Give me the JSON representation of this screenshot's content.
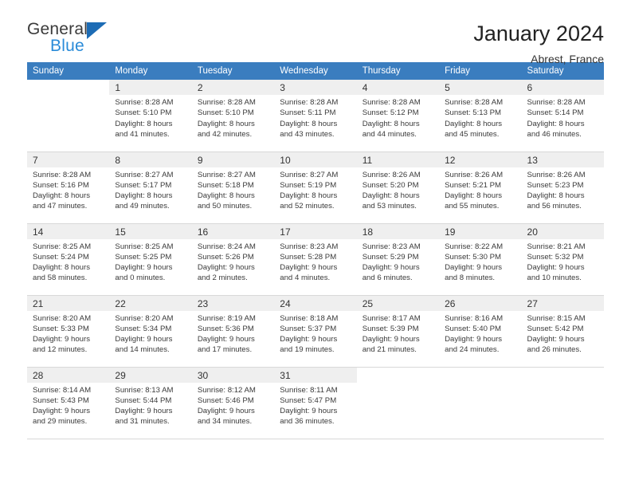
{
  "logo": {
    "word1": "General",
    "word2": "Blue",
    "triangle_color": "#1d6cb5",
    "blue_color": "#2a8bd8"
  },
  "header": {
    "title": "January 2024",
    "subtitle": "Abrest, France"
  },
  "theme": {
    "header_bar": "#3a7dbf",
    "row_shade": "#efefef",
    "text": "#333333"
  },
  "weekdays": [
    "Sunday",
    "Monday",
    "Tuesday",
    "Wednesday",
    "Thursday",
    "Friday",
    "Saturday"
  ],
  "labels": {
    "sunrise": "Sunrise",
    "sunset": "Sunset",
    "daylight": "Daylight"
  },
  "weeks": [
    {
      "shaded": true,
      "days": [
        {
          "num": "",
          "info": ""
        },
        {
          "num": "1",
          "info": "Sunrise: 8:28 AM\nSunset: 5:10 PM\nDaylight: 8 hours\nand 41 minutes."
        },
        {
          "num": "2",
          "info": "Sunrise: 8:28 AM\nSunset: 5:10 PM\nDaylight: 8 hours\nand 42 minutes."
        },
        {
          "num": "3",
          "info": "Sunrise: 8:28 AM\nSunset: 5:11 PM\nDaylight: 8 hours\nand 43 minutes."
        },
        {
          "num": "4",
          "info": "Sunrise: 8:28 AM\nSunset: 5:12 PM\nDaylight: 8 hours\nand 44 minutes."
        },
        {
          "num": "5",
          "info": "Sunrise: 8:28 AM\nSunset: 5:13 PM\nDaylight: 8 hours\nand 45 minutes."
        },
        {
          "num": "6",
          "info": "Sunrise: 8:28 AM\nSunset: 5:14 PM\nDaylight: 8 hours\nand 46 minutes."
        }
      ]
    },
    {
      "shaded": true,
      "days": [
        {
          "num": "7",
          "info": "Sunrise: 8:28 AM\nSunset: 5:16 PM\nDaylight: 8 hours\nand 47 minutes."
        },
        {
          "num": "8",
          "info": "Sunrise: 8:27 AM\nSunset: 5:17 PM\nDaylight: 8 hours\nand 49 minutes."
        },
        {
          "num": "9",
          "info": "Sunrise: 8:27 AM\nSunset: 5:18 PM\nDaylight: 8 hours\nand 50 minutes."
        },
        {
          "num": "10",
          "info": "Sunrise: 8:27 AM\nSunset: 5:19 PM\nDaylight: 8 hours\nand 52 minutes."
        },
        {
          "num": "11",
          "info": "Sunrise: 8:26 AM\nSunset: 5:20 PM\nDaylight: 8 hours\nand 53 minutes."
        },
        {
          "num": "12",
          "info": "Sunrise: 8:26 AM\nSunset: 5:21 PM\nDaylight: 8 hours\nand 55 minutes."
        },
        {
          "num": "13",
          "info": "Sunrise: 8:26 AM\nSunset: 5:23 PM\nDaylight: 8 hours\nand 56 minutes."
        }
      ]
    },
    {
      "shaded": true,
      "days": [
        {
          "num": "14",
          "info": "Sunrise: 8:25 AM\nSunset: 5:24 PM\nDaylight: 8 hours\nand 58 minutes."
        },
        {
          "num": "15",
          "info": "Sunrise: 8:25 AM\nSunset: 5:25 PM\nDaylight: 9 hours\nand 0 minutes."
        },
        {
          "num": "16",
          "info": "Sunrise: 8:24 AM\nSunset: 5:26 PM\nDaylight: 9 hours\nand 2 minutes."
        },
        {
          "num": "17",
          "info": "Sunrise: 8:23 AM\nSunset: 5:28 PM\nDaylight: 9 hours\nand 4 minutes."
        },
        {
          "num": "18",
          "info": "Sunrise: 8:23 AM\nSunset: 5:29 PM\nDaylight: 9 hours\nand 6 minutes."
        },
        {
          "num": "19",
          "info": "Sunrise: 8:22 AM\nSunset: 5:30 PM\nDaylight: 9 hours\nand 8 minutes."
        },
        {
          "num": "20",
          "info": "Sunrise: 8:21 AM\nSunset: 5:32 PM\nDaylight: 9 hours\nand 10 minutes."
        }
      ]
    },
    {
      "shaded": true,
      "days": [
        {
          "num": "21",
          "info": "Sunrise: 8:20 AM\nSunset: 5:33 PM\nDaylight: 9 hours\nand 12 minutes."
        },
        {
          "num": "22",
          "info": "Sunrise: 8:20 AM\nSunset: 5:34 PM\nDaylight: 9 hours\nand 14 minutes."
        },
        {
          "num": "23",
          "info": "Sunrise: 8:19 AM\nSunset: 5:36 PM\nDaylight: 9 hours\nand 17 minutes."
        },
        {
          "num": "24",
          "info": "Sunrise: 8:18 AM\nSunset: 5:37 PM\nDaylight: 9 hours\nand 19 minutes."
        },
        {
          "num": "25",
          "info": "Sunrise: 8:17 AM\nSunset: 5:39 PM\nDaylight: 9 hours\nand 21 minutes."
        },
        {
          "num": "26",
          "info": "Sunrise: 8:16 AM\nSunset: 5:40 PM\nDaylight: 9 hours\nand 24 minutes."
        },
        {
          "num": "27",
          "info": "Sunrise: 8:15 AM\nSunset: 5:42 PM\nDaylight: 9 hours\nand 26 minutes."
        }
      ]
    },
    {
      "shaded": true,
      "days": [
        {
          "num": "28",
          "info": "Sunrise: 8:14 AM\nSunset: 5:43 PM\nDaylight: 9 hours\nand 29 minutes."
        },
        {
          "num": "29",
          "info": "Sunrise: 8:13 AM\nSunset: 5:44 PM\nDaylight: 9 hours\nand 31 minutes."
        },
        {
          "num": "30",
          "info": "Sunrise: 8:12 AM\nSunset: 5:46 PM\nDaylight: 9 hours\nand 34 minutes."
        },
        {
          "num": "31",
          "info": "Sunrise: 8:11 AM\nSunset: 5:47 PM\nDaylight: 9 hours\nand 36 minutes."
        },
        {
          "num": "",
          "info": ""
        },
        {
          "num": "",
          "info": ""
        },
        {
          "num": "",
          "info": ""
        }
      ]
    }
  ]
}
